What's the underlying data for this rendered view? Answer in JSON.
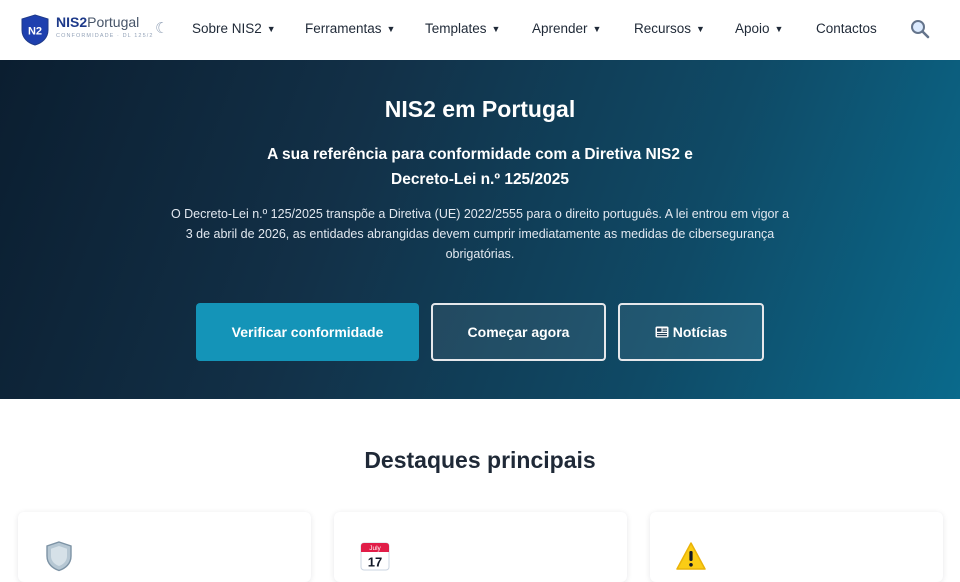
{
  "brand": {
    "badge": "N2",
    "name_bold": "NIS2",
    "name_light": "Portugal",
    "tagline": "CONFORMIDADE · DL 125/2"
  },
  "nav": {
    "items": [
      {
        "label": "Sobre NIS2",
        "dropdown": true
      },
      {
        "label": "Ferramentas",
        "dropdown": true
      },
      {
        "label": "Templates",
        "dropdown": true
      },
      {
        "label": "Aprender",
        "dropdown": true
      },
      {
        "label": "Recursos",
        "dropdown": true
      },
      {
        "label": "Apoio",
        "dropdown": true
      },
      {
        "label": "Contactos",
        "dropdown": false
      }
    ],
    "caret": "▼",
    "theme_toggle_icon": "moon-icon",
    "search_icon": "search-icon"
  },
  "hero": {
    "title": "NIS2 em Portugal",
    "subtitle_line1": "A sua referência para conformidade com a Diretiva NIS2 e",
    "subtitle_line2": "Decreto-Lei n.º 125/2025",
    "description": "O Decreto-Lei n.º 125/2025 transpõe a Diretiva (UE) 2022/2555 para o direito português. A lei entrou em vigor a 3 de abril de 2026, as entidades abrangidas devem cumprir imediatamente as medidas de cibersegurança obrigatórias.",
    "buttons": {
      "check": "Verificar conformidade",
      "start": "Começar agora",
      "news": "Notícias"
    }
  },
  "highlights": {
    "title": "Destaques principais",
    "cards": [
      {
        "icon": "shield-icon"
      },
      {
        "icon": "calendar-icon",
        "month": "July",
        "day": "17"
      },
      {
        "icon": "warning-icon"
      }
    ]
  },
  "colors": {
    "primary_button": "#1494b8",
    "brand_blue": "#1e3a8a",
    "hero_start": "#0b1e30",
    "hero_end": "#0a6a8c"
  }
}
